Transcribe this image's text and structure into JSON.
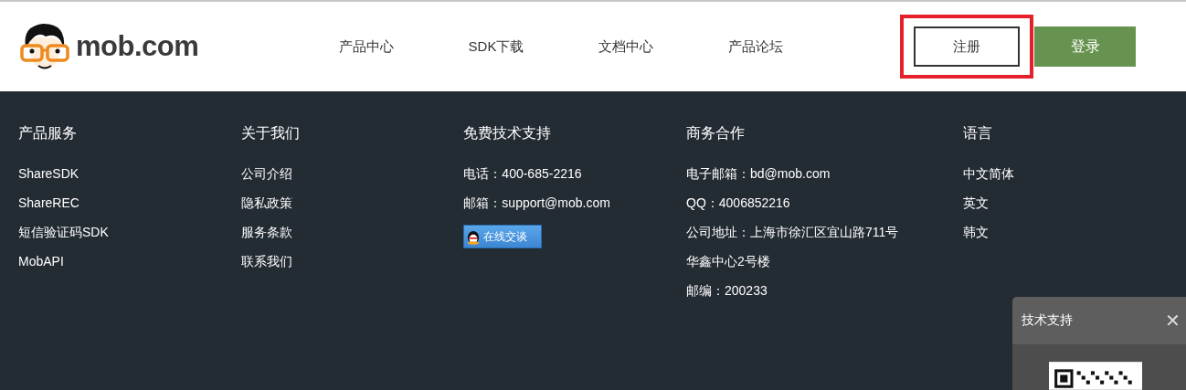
{
  "header": {
    "logo_text": "mob.com",
    "nav": [
      {
        "label": "产品中心"
      },
      {
        "label": "SDK下载"
      },
      {
        "label": "文档中心"
      },
      {
        "label": "产品论坛"
      }
    ],
    "register_button": {
      "label": "注册",
      "highlighted": true
    },
    "login_button": {
      "label": "登录"
    }
  },
  "footer": {
    "columns": [
      {
        "heading": "产品服务",
        "items": [
          {
            "kind": "link",
            "text": "ShareSDK"
          },
          {
            "kind": "link",
            "text": "ShareREC"
          },
          {
            "kind": "link",
            "text": "短信验证码SDK"
          },
          {
            "kind": "link",
            "text": "MobAPI"
          }
        ]
      },
      {
        "heading": "关于我们",
        "items": [
          {
            "kind": "link",
            "text": "公司介绍"
          },
          {
            "kind": "link",
            "text": "隐私政策"
          },
          {
            "kind": "link",
            "text": "服务条款"
          },
          {
            "kind": "link",
            "text": "联系我们"
          }
        ]
      },
      {
        "heading": "免费技术支持",
        "items": [
          {
            "kind": "text",
            "text": "电话：400-685-2216"
          },
          {
            "kind": "text",
            "text": "邮箱：support@mob.com"
          },
          {
            "kind": "chat_button",
            "text": "在线交谈"
          }
        ]
      },
      {
        "heading": "商务合作",
        "items": [
          {
            "kind": "text",
            "text": "电子邮箱：bd@mob.com"
          },
          {
            "kind": "text",
            "text": "QQ：4006852216"
          },
          {
            "kind": "text",
            "text": "公司地址：上海市徐汇区宜山路711号"
          },
          {
            "kind": "text",
            "text": "华鑫中心2号楼"
          },
          {
            "kind": "text",
            "text": "邮编：200233"
          }
        ]
      },
      {
        "heading": "语言",
        "items": [
          {
            "kind": "link",
            "text": "中文简体"
          },
          {
            "kind": "link",
            "text": "英文"
          },
          {
            "kind": "link",
            "text": "韩文"
          }
        ]
      }
    ]
  },
  "support_panel": {
    "title": "技术支持",
    "close": "✕"
  }
}
